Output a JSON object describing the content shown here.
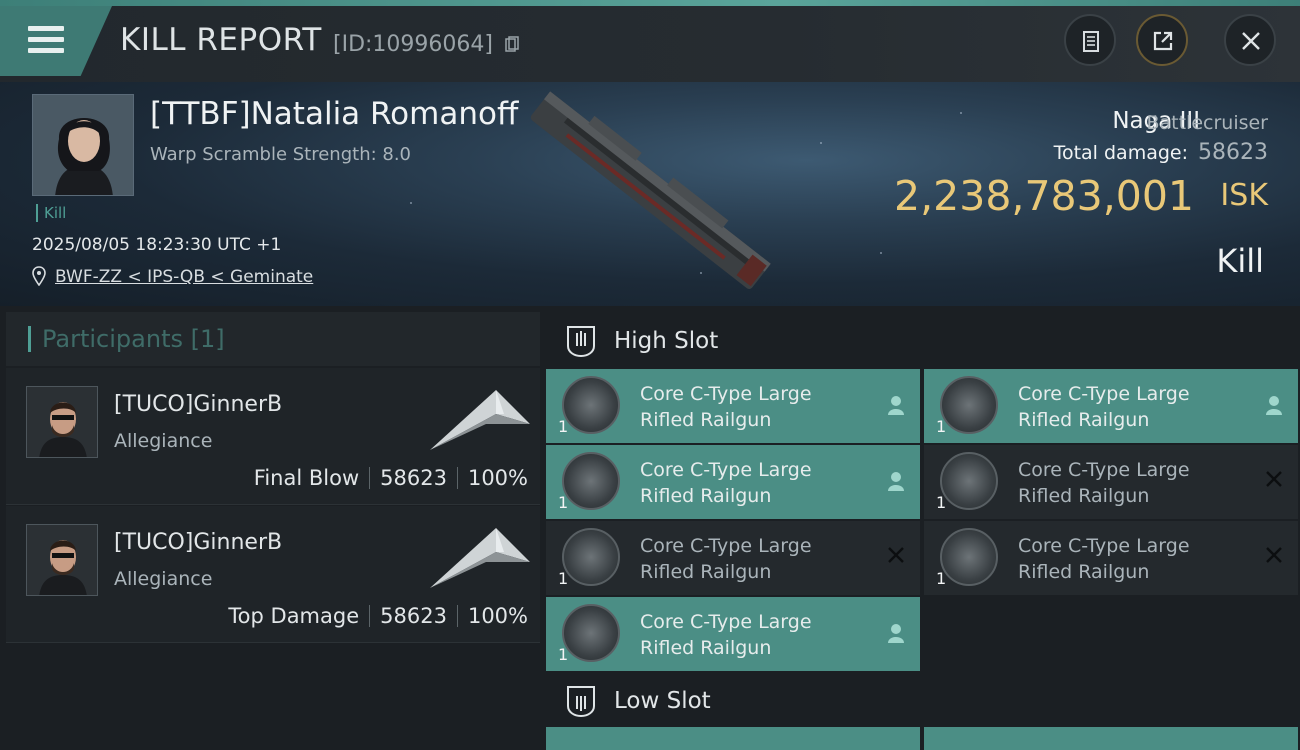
{
  "header": {
    "title": "KILL REPORT",
    "report_id": "[ID:10996064]"
  },
  "victim": {
    "name": "[TTBF]Natalia Romanoff",
    "warp_scramble": "Warp Scramble Strength: 8.0",
    "tag": "Kill",
    "timestamp": "2025/08/05 18:23:30 UTC +1",
    "location": "BWF-ZZ < IPS-QB < Geminate"
  },
  "ship": {
    "name": "Naga III",
    "class": "Battlecruiser",
    "total_damage_label": "Total damage:",
    "total_damage": "58623",
    "isk_value": "2,238,783,001",
    "isk_unit": "ISK",
    "result": "Kill"
  },
  "participants": {
    "title": "Participants [1]",
    "items": [
      {
        "name": "[TUCO]GinnerB",
        "corp": "Allegiance",
        "role": "Final Blow",
        "damage": "58623",
        "percent": "100%"
      },
      {
        "name": "[TUCO]GinnerB",
        "corp": "Allegiance",
        "role": "Top Damage",
        "damage": "58623",
        "percent": "100%"
      }
    ]
  },
  "high_slot": {
    "title": "High Slot",
    "modules": [
      {
        "name_line1": "Core C-Type Large",
        "name_line2": "Rifled Railgun",
        "qty": "1",
        "state": "dropped"
      },
      {
        "name_line1": "Core C-Type Large",
        "name_line2": "Rifled Railgun",
        "qty": "1",
        "state": "dropped"
      },
      {
        "name_line1": "Core C-Type Large",
        "name_line2": "Rifled Railgun",
        "qty": "1",
        "state": "dropped"
      },
      {
        "name_line1": "Core C-Type Large",
        "name_line2": "Rifled Railgun",
        "qty": "1",
        "state": "destroyed"
      },
      {
        "name_line1": "Core C-Type Large",
        "name_line2": "Rifled Railgun",
        "qty": "1",
        "state": "destroyed"
      },
      {
        "name_line1": "Core C-Type Large",
        "name_line2": "Rifled Railgun",
        "qty": "1",
        "state": "destroyed"
      },
      {
        "name_line1": "Core C-Type Large",
        "name_line2": "Rifled Railgun",
        "qty": "1",
        "state": "dropped"
      }
    ]
  },
  "low_slot": {
    "title": "Low Slot"
  },
  "colors": {
    "accent": "#4b8e85",
    "isk": "#e9c878",
    "module_on": "#4b8e85",
    "module_off": "#24292d"
  },
  "icons": [
    "menu-icon",
    "copy-icon",
    "clipboard-icon",
    "share-icon",
    "close-icon",
    "location-pin-icon",
    "slot-icon",
    "pilot-icon",
    "destroyed-x-icon"
  ]
}
